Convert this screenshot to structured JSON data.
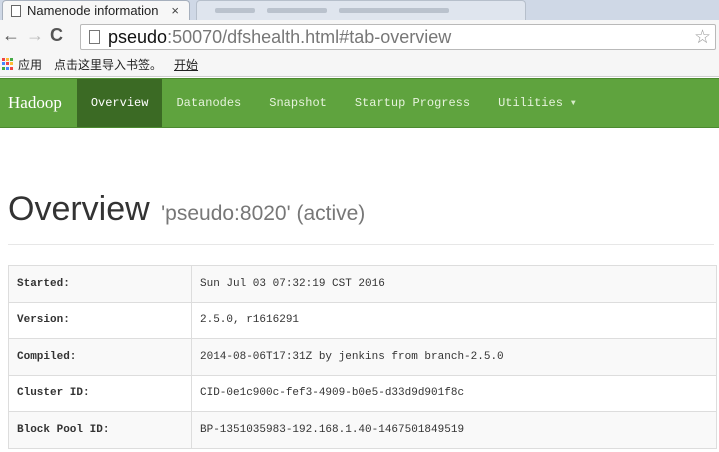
{
  "browser": {
    "tab_title": "Namenode information",
    "tab_close": "×",
    "url_host": "pseudo",
    "url_rest": ":50070/dfshealth.html#tab-overview",
    "back": "←",
    "forward": "→",
    "reload": "C",
    "star": "☆"
  },
  "bookmarks": {
    "apps_label": "应用",
    "import_label": "点击这里导入书签。",
    "start_label": "开始"
  },
  "navbar": {
    "brand": "Hadoop",
    "items": [
      {
        "label": "Overview",
        "active": true
      },
      {
        "label": "Datanodes"
      },
      {
        "label": "Snapshot"
      },
      {
        "label": "Startup Progress"
      },
      {
        "label": "Utilities",
        "dropdown": true
      }
    ]
  },
  "overview": {
    "title": "Overview",
    "subtitle": "'pseudo:8020' (active)"
  },
  "info_table": [
    {
      "label": "Started:",
      "value": "Sun Jul 03 07:32:19 CST 2016"
    },
    {
      "label": "Version:",
      "value": "2.5.0, r1616291"
    },
    {
      "label": "Compiled:",
      "value": "2014-08-06T17:31Z by jenkins from branch-2.5.0"
    },
    {
      "label": "Cluster ID:",
      "value": "CID-0e1c900c-fef3-4909-b0e5-d33d9d901f8c"
    },
    {
      "label": "Block Pool ID:",
      "value": "BP-1351035983-192.168.1.40-1467501849519"
    }
  ],
  "colors": {
    "navbar_green": "#5fa33e",
    "navbar_active": "#3b6a24"
  }
}
